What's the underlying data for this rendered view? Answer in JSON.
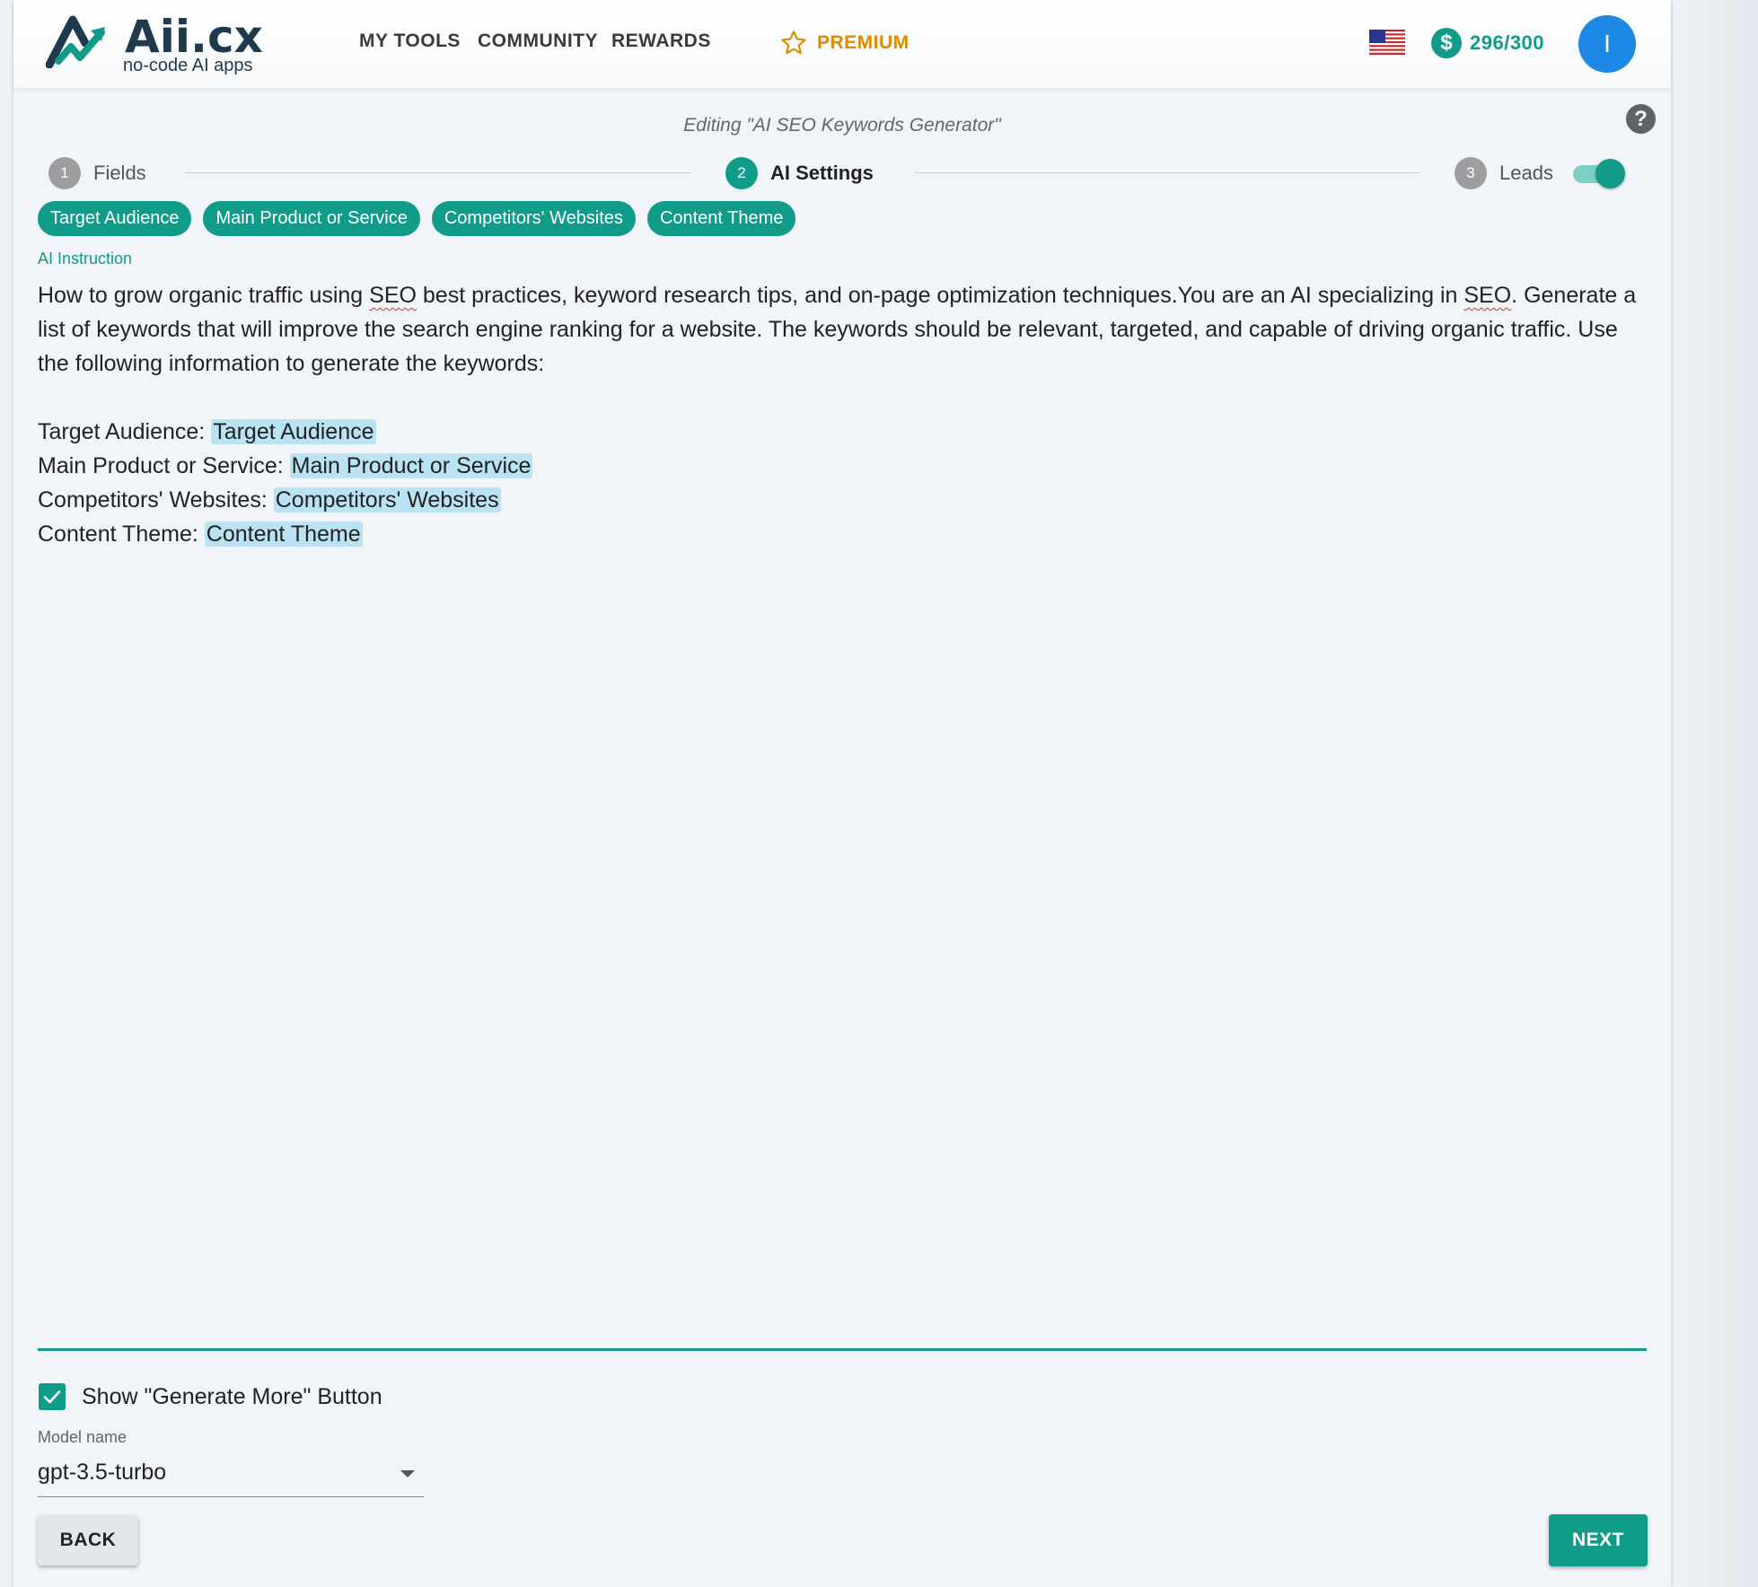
{
  "header": {
    "logo": {
      "title_main": "Aii.",
      "title_accent": "cx",
      "subtitle": "no-code AI apps"
    },
    "nav": [
      {
        "label": "MY TOOLS"
      },
      {
        "label": "COMMUNITY"
      },
      {
        "label": "REWARDS"
      },
      {
        "label": "PREMIUM",
        "icon": "star-outline-icon"
      }
    ],
    "language_flag": "us-flag-icon",
    "credits": {
      "icon_symbol": "$",
      "amount": "296/300"
    },
    "avatar_initial": "I"
  },
  "editor": {
    "title": "Editing \"AI SEO Keywords Generator\"",
    "help_symbol": "?"
  },
  "stepper": {
    "steps": [
      {
        "number": "1",
        "label": "Fields",
        "active": false
      },
      {
        "number": "2",
        "label": "AI Settings",
        "active": true
      },
      {
        "number": "3",
        "label": "Leads",
        "active": false
      }
    ],
    "leads_toggle_on": true
  },
  "variable_chips": [
    "Target Audience",
    "Main Product or Service",
    "Competitors' Websites",
    "Content Theme"
  ],
  "ai_instruction": {
    "label": "AI Instruction",
    "intro_1": "How to grow organic traffic using ",
    "seo_1": "SEO",
    "intro_2": " best practices, keyword research tips, and on-page optimization techniques.You are an AI specializing in ",
    "seo_2": "SEO",
    "intro_3": ".",
    "intro_4": "Generate a list of keywords that will improve the search engine ranking for a website. The keywords should be relevant, targeted, and capable of driving organic traffic. Use the following information to generate the keywords:",
    "lines": [
      {
        "prefix": "Target Audience: ",
        "variable": "Target Audience"
      },
      {
        "prefix": "Main Product or Service: ",
        "variable": "Main Product or Service"
      },
      {
        "prefix": "Competitors' Websites: ",
        "variable": "Competitors' Websites"
      },
      {
        "prefix": "Content Theme: ",
        "variable": "Content Theme"
      }
    ]
  },
  "options": {
    "generate_more_label": "Show \"Generate More\" Button",
    "generate_more_checked": true,
    "model_label": "Model name",
    "model_value": "gpt-3.5-turbo"
  },
  "buttons": {
    "back": "BACK",
    "next": "NEXT"
  },
  "colors": {
    "accent": "#119c8a",
    "premium": "#e08a00",
    "avatar": "#1e88e5",
    "variable_highlight": "#b9e3f3"
  }
}
